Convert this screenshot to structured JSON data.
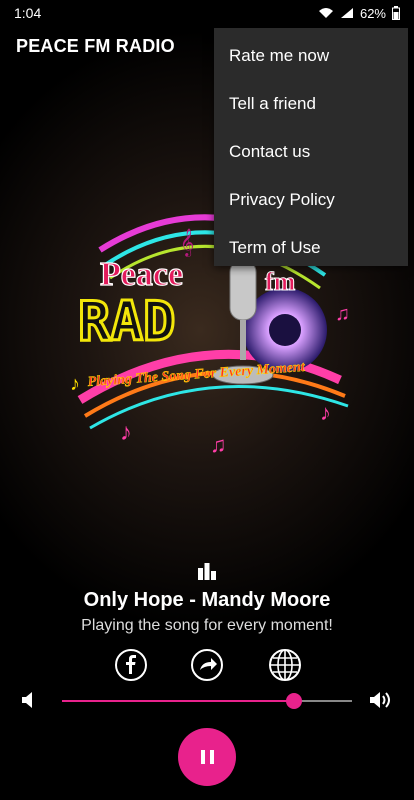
{
  "status_bar": {
    "time": "1:04",
    "battery": "62%"
  },
  "app_bar": {
    "title": "PEACE FM RADIO"
  },
  "menu": {
    "items": [
      {
        "label": "Rate me now"
      },
      {
        "label": "Tell a friend"
      },
      {
        "label": "Contact us"
      },
      {
        "label": "Privacy Policy"
      },
      {
        "label": "Term of Use"
      }
    ]
  },
  "logo": {
    "line1": "Peace",
    "line1b": "fm",
    "line2": "RAD",
    "tagline": "Playing The Song For Every Moment"
  },
  "player": {
    "song_title": "Only Hope - Mandy Moore",
    "subtitle": "Playing the song for every moment!",
    "volume": 0.8,
    "accent_color": "#e8228c"
  },
  "icons": {
    "equalizer": "equalizer-icon",
    "facebook": "facebook-icon",
    "share": "share-icon",
    "website": "globe-icon",
    "volume_down": "volume-down-icon",
    "volume_up": "volume-up-icon",
    "pause": "pause-icon"
  }
}
